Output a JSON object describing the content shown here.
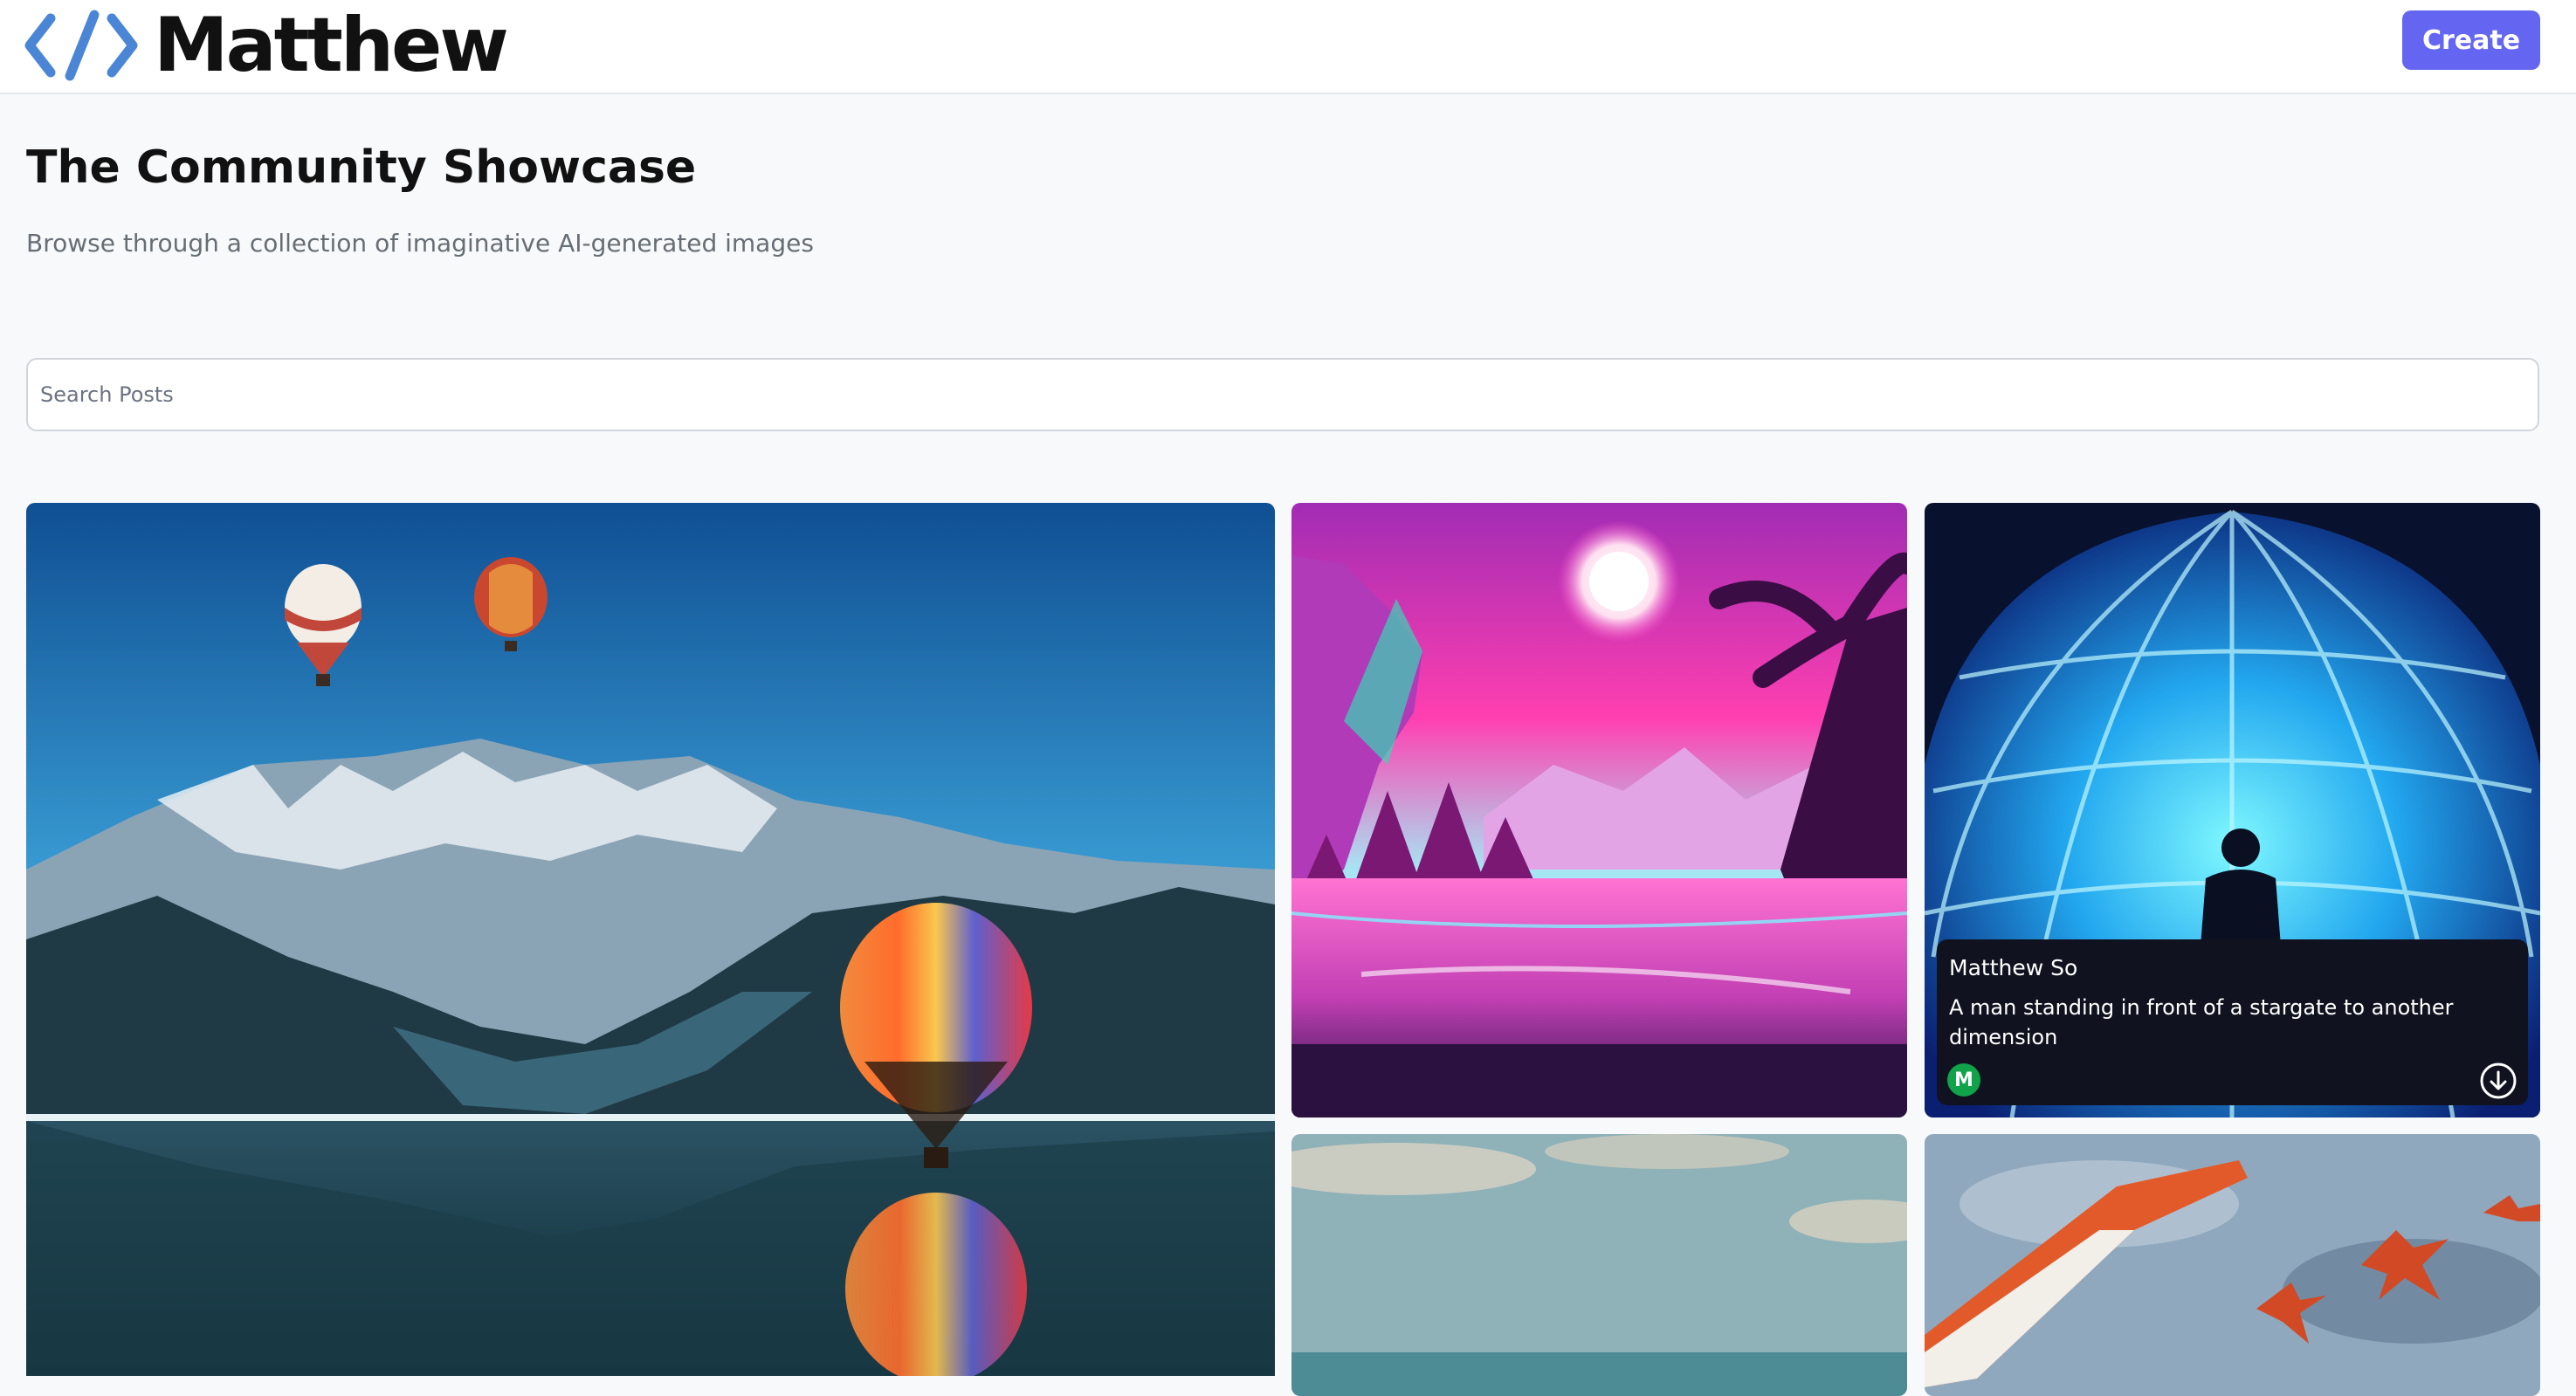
{
  "header": {
    "logo_text": "Matthew",
    "create_label": "Create"
  },
  "main": {
    "title": "The Community Showcase",
    "subtitle": "Browse through a collection of imaginative AI-generated images"
  },
  "search": {
    "placeholder": "Search Posts",
    "value": ""
  },
  "posts": [
    {
      "image": "hot-air-balloons-over-mountain-lake"
    },
    {
      "image": "synthwave-pink-lake-sunset"
    },
    {
      "image": "glowing-blue-stargate-dome",
      "author": "Matthew So",
      "prompt": "A man standing in front of a stargate to another dimension",
      "avatar_initial": "M",
      "hovered": true
    },
    {
      "image": "cloudy-sky-seascape"
    },
    {
      "image": "red-spaceships-flying-over-city"
    }
  ],
  "colors": {
    "accent": "#6466f1",
    "page_bg": "#f8f9fb",
    "overlay_bg": "#10131f",
    "avatar_bg": "#10a34a"
  }
}
